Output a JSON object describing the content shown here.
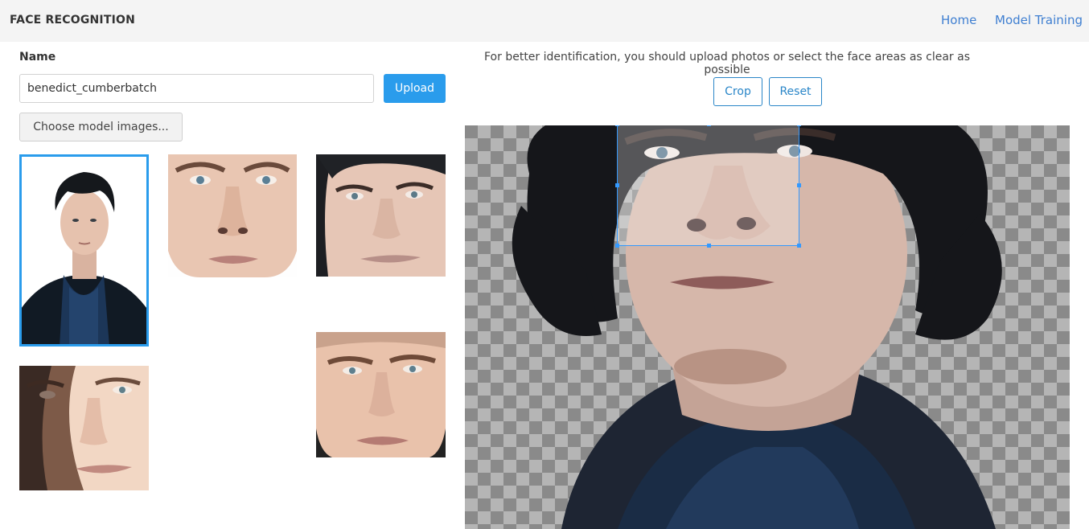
{
  "navbar": {
    "brand": "FACE RECOGNITION",
    "links": [
      {
        "label": "Home"
      },
      {
        "label": "Model Training"
      }
    ]
  },
  "form": {
    "name_label": "Name",
    "name_value": "benedict_cumberbatch",
    "upload_label": "Upload",
    "choose_label": "Choose model images..."
  },
  "thumbnails": [
    {
      "name": "portrait-full",
      "selected": true
    },
    {
      "name": "face-closeup-1",
      "selected": false
    },
    {
      "name": "face-closeup-2",
      "selected": false
    },
    {
      "name": "face-closeup-3",
      "selected": false
    },
    {
      "name": "face-closeup-4",
      "selected": false
    }
  ],
  "editor": {
    "hint": "For better identification, you should upload photos or select the face areas as clear as possible",
    "crop_label": "Crop",
    "reset_label": "Reset"
  },
  "colors": {
    "accent": "#2a9cec",
    "link": "#3f7fd1",
    "navbar_bg": "#f4f4f4"
  }
}
